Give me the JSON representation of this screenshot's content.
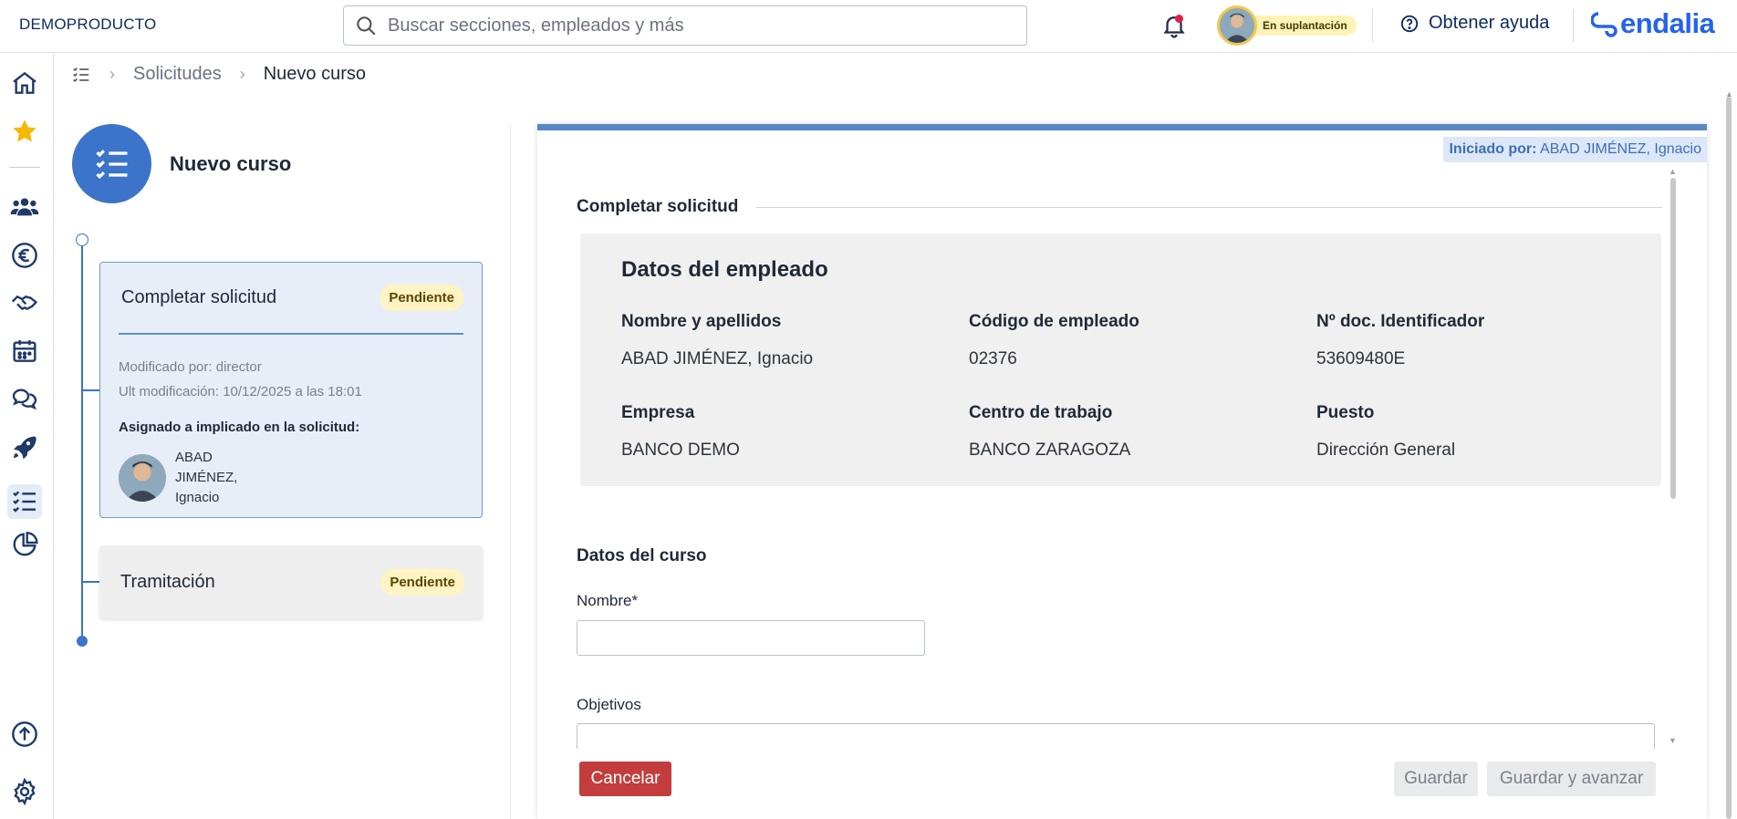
{
  "topbar": {
    "company": "DEMOPRODUCTO",
    "search_placeholder": "Buscar secciones, empleados y más",
    "impersonation_badge": "En suplantación",
    "help_label": "Obtener ayuda",
    "logo_text": "endalia"
  },
  "nav": {
    "items": [
      "home-icon",
      "star-icon",
      "people-icon",
      "euro-icon",
      "handshake-icon",
      "calendar-icon",
      "chat-icon",
      "rocket-icon",
      "checklist-icon",
      "pie-chart-icon"
    ],
    "bottom": [
      "upload-icon",
      "gear-icon"
    ]
  },
  "breadcrumb": {
    "parent": "Solicitudes",
    "current": "Nuevo curso"
  },
  "workflow": {
    "title": "Nuevo curso",
    "steps": [
      {
        "name": "Completar solicitud",
        "status": "Pendiente",
        "modified_by": "Modificado por: director",
        "last_modified": "Ult modificación: 10/12/2025 a las 18:01",
        "assigned_label": "Asignado a implicado en la solicitud:",
        "assignee_line1": "ABAD",
        "assignee_line2": "JIMÉNEZ,",
        "assignee_line3": "Ignacio"
      },
      {
        "name": "Tramitación",
        "status": "Pendiente"
      }
    ]
  },
  "panel": {
    "initiated_label": "Iniciado por:",
    "initiated_value": "ABAD JIMÉNEZ, Ignacio",
    "section_title": "Completar solicitud",
    "employee": {
      "title": "Datos del empleado",
      "fields": [
        {
          "label": "Nombre y apellidos",
          "value": "ABAD JIMÉNEZ, Ignacio"
        },
        {
          "label": "Código de empleado",
          "value": "02376"
        },
        {
          "label": "Nº doc. Identificador",
          "value": "53609480E"
        },
        {
          "label": "Empresa",
          "value": "BANCO DEMO"
        },
        {
          "label": "Centro de trabajo",
          "value": "BANCO ZARAGOZA"
        },
        {
          "label": "Puesto",
          "value": "Dirección General"
        }
      ]
    },
    "course": {
      "title": "Datos del curso",
      "name_label": "Nombre*",
      "name_value": "",
      "objectives_label": "Objetivos",
      "objectives_value": ""
    },
    "buttons": {
      "cancel": "Cancelar",
      "save": "Guardar",
      "save_advance": "Guardar y avanzar"
    }
  },
  "colors": {
    "brand_blue": "#3b74c8",
    "cancel_red": "#c43d3d",
    "pending_bg": "#fff3c4",
    "active_card_bg": "#e7eef8"
  }
}
